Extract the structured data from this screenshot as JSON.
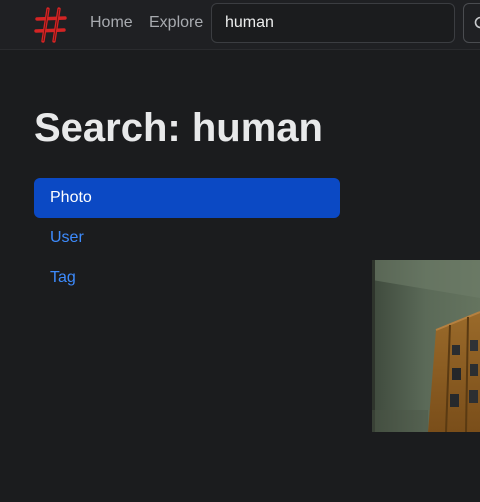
{
  "nav": {
    "logo_icon": "hash-logo-icon",
    "home_label": "Home",
    "explore_label": "Explore",
    "search_value": "human",
    "search_icon": "search-icon"
  },
  "page": {
    "title": "Search: human"
  },
  "tabs": [
    {
      "label": "Photo",
      "active": true
    },
    {
      "label": "User",
      "active": false
    },
    {
      "label": "Tag",
      "active": false
    }
  ],
  "colors": {
    "background": "#1b1c1e",
    "navbar": "#1f2023",
    "accent_active": "#0b49c4",
    "link": "#3d8bfd",
    "logo": "#d42424"
  }
}
